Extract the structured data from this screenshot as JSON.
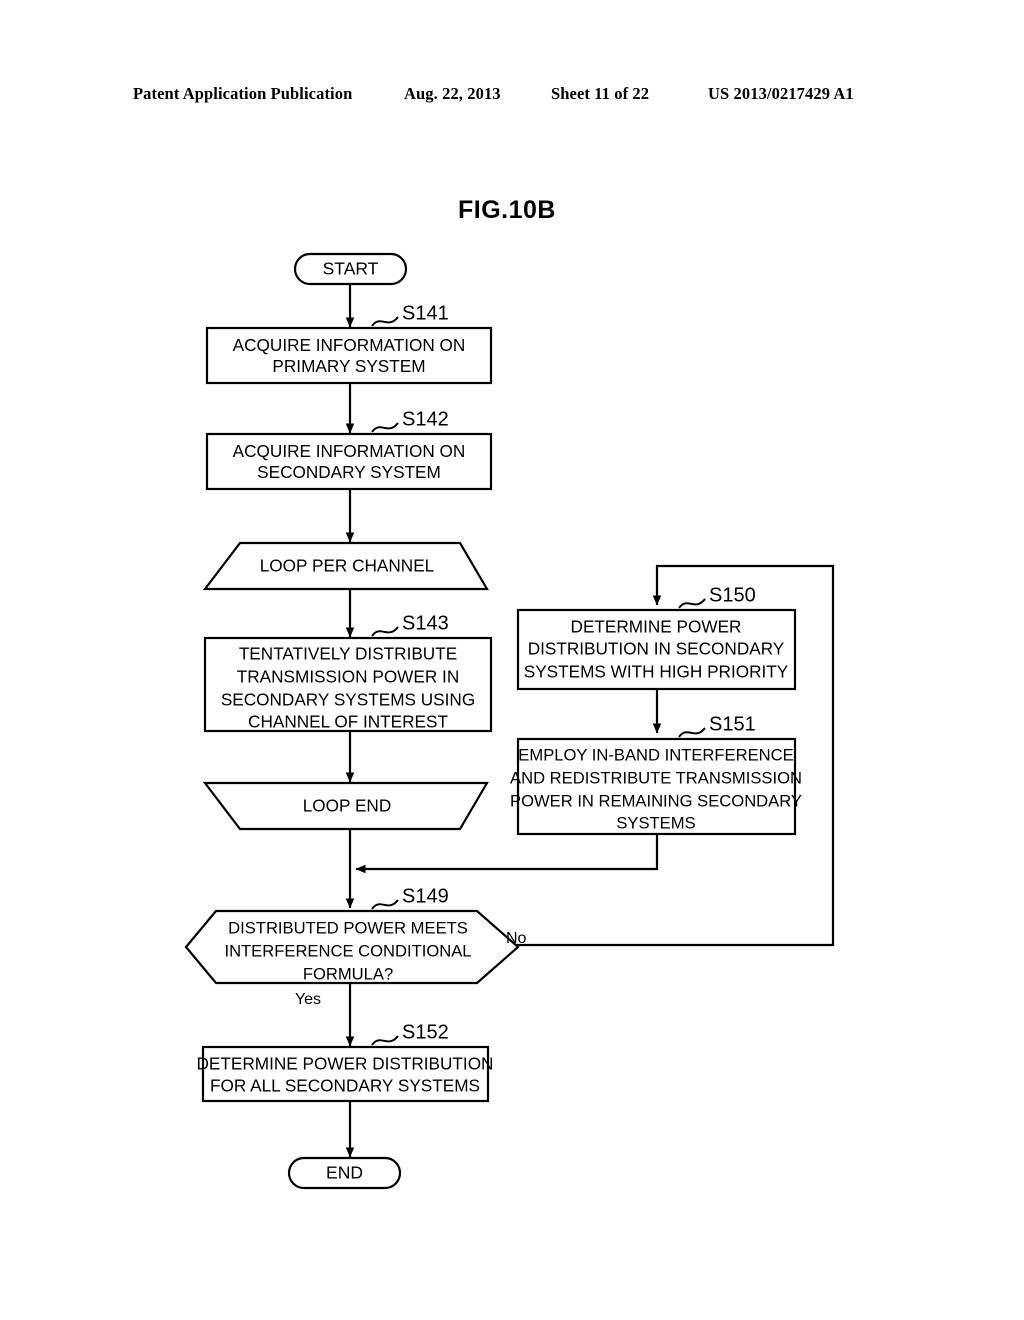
{
  "header": {
    "publication": "Patent Application Publication",
    "date": "Aug. 22, 2013",
    "sheet": "Sheet 11 of 22",
    "patent_number": "US 2013/0217429 A1"
  },
  "figure": {
    "title": "FIG.10B"
  },
  "flowchart": {
    "start_label": "START",
    "end_label": "END",
    "branch_yes": "Yes",
    "branch_no": "No",
    "nodes": [
      {
        "id": "s141",
        "step": "S141",
        "shape": "process",
        "lines": [
          "ACQUIRE INFORMATION ON",
          "PRIMARY SYSTEM"
        ]
      },
      {
        "id": "s142",
        "step": "S142",
        "shape": "process",
        "lines": [
          "ACQUIRE INFORMATION ON",
          "SECONDARY SYSTEM"
        ]
      },
      {
        "id": "loop_start",
        "step": "",
        "shape": "loop-start",
        "lines": [
          "LOOP PER CHANNEL"
        ]
      },
      {
        "id": "s143",
        "step": "S143",
        "shape": "process",
        "lines": [
          "TENTATIVELY DISTRIBUTE",
          "TRANSMISSION POWER IN",
          "SECONDARY SYSTEMS USING",
          "CHANNEL OF INTEREST"
        ]
      },
      {
        "id": "loop_end",
        "step": "",
        "shape": "loop-end",
        "lines": [
          "LOOP END"
        ]
      },
      {
        "id": "s149",
        "step": "S149",
        "shape": "decision",
        "lines": [
          "DISTRIBUTED POWER MEETS",
          "INTERFERENCE CONDITIONAL",
          "FORMULA?"
        ]
      },
      {
        "id": "s152",
        "step": "S152",
        "shape": "process",
        "lines": [
          "DETERMINE POWER DISTRIBUTION",
          "FOR ALL SECONDARY SYSTEMS"
        ]
      },
      {
        "id": "s150",
        "step": "S150",
        "shape": "process",
        "lines": [
          "DETERMINE POWER",
          "DISTRIBUTION IN SECONDARY",
          "SYSTEMS WITH HIGH PRIORITY"
        ]
      },
      {
        "id": "s151",
        "step": "S151",
        "shape": "process",
        "lines": [
          "EMPLOY IN-BAND INTERFERENCE",
          "AND REDISTRIBUTE TRANSMISSION",
          "POWER IN REMAINING SECONDARY",
          "SYSTEMS"
        ]
      }
    ]
  },
  "colors": {
    "ink": "#000000",
    "paper": "#ffffff"
  }
}
